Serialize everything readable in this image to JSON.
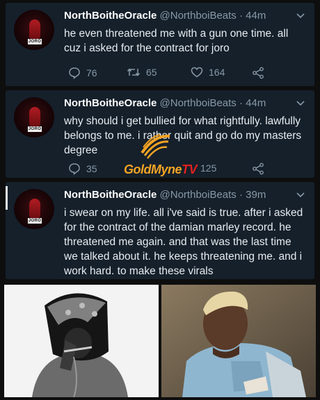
{
  "tweets": [
    {
      "name": "NorthBoitheOracle",
      "handle": "@NorthboiBeats",
      "time": "· 44m",
      "text": "he even threatened me with a gun one time. all cuz i asked for the contract for joro",
      "replies": "76",
      "retweets": "65",
      "likes": "164",
      "avatar_tag": "JORO"
    },
    {
      "name": "NorthBoitheOracle",
      "handle": "@NorthboiBeats",
      "time": "· 44m",
      "text": "why should i get bullied for what rightfully. lawfully belongs to me. i rather quit and go do my masters degree",
      "replies": "35",
      "likes": "125",
      "avatar_tag": "JORO"
    },
    {
      "name": "NorthBoitheOracle",
      "handle": "@NorthboiBeats",
      "time": "· 39m",
      "text": "i swear on my life. all i've said is true. after i asked for the contract of the damian marley record. he threatened me again. and that was the last time we talked about it. he keeps threatening me. and i work hard. to make these virals",
      "avatar_tag": "JORO"
    }
  ],
  "watermark": {
    "brand": "GoldMyne",
    "suffix": "TV"
  },
  "icons": {
    "reply": "reply-icon",
    "retweet": "retweet-icon",
    "like": "heart-icon",
    "share": "share-icon",
    "menu": "chevron-down-icon"
  },
  "colors": {
    "card_bg": "#15202b",
    "secondary_text": "#8899a6",
    "watermark_gold": "#f2a324",
    "watermark_red": "#e02020"
  }
}
